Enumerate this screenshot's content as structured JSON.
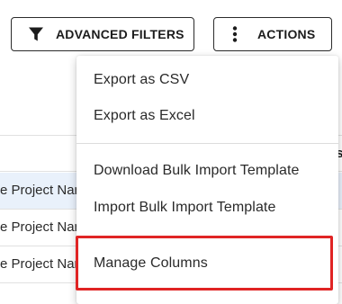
{
  "toolbar": {
    "filters_label": "ADVANCED FILTERS",
    "filters_icon": "filter-icon",
    "actions_label": "ACTIONS",
    "actions_icon": "more-vert-icon"
  },
  "table": {
    "header_fragment": "us",
    "rows": [
      {
        "name": "e Project Name"
      },
      {
        "name": "e Project Name"
      },
      {
        "name": "e Project Name"
      }
    ]
  },
  "menu": {
    "items": [
      {
        "label": "Export as CSV"
      },
      {
        "label": "Export as Excel"
      },
      {
        "label": "Download Bulk Import Template"
      },
      {
        "label": "Import Bulk Import Template"
      },
      {
        "label": "Manage Columns"
      }
    ],
    "highlight_color": "#e02424"
  }
}
